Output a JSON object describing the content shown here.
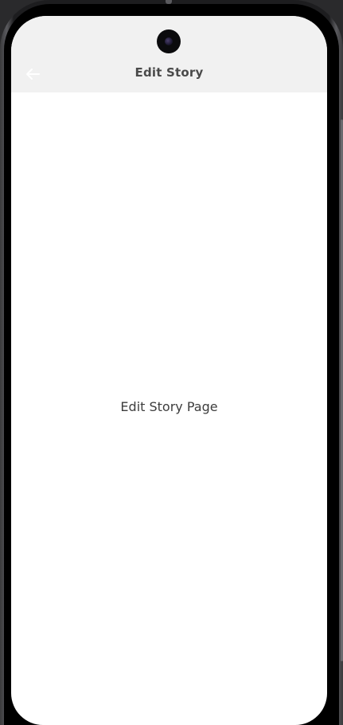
{
  "app_bar": {
    "title": "Edit Story",
    "back_icon": "arrow-left-icon",
    "background_color": "#f1f1f1"
  },
  "body": {
    "text": "Edit Story Page"
  }
}
